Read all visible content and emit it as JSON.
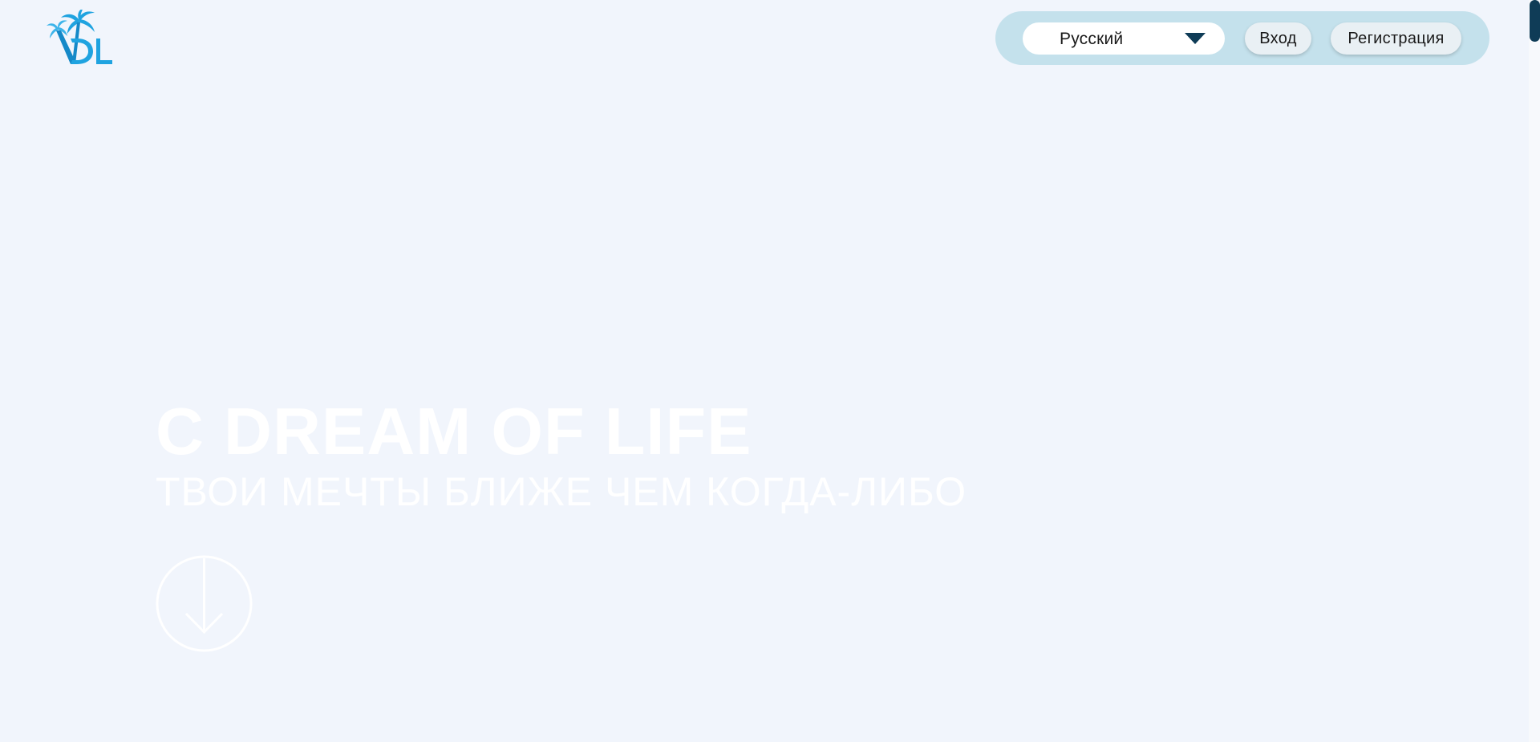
{
  "header": {
    "logo_icon": "vdl-palm-logo-icon",
    "language": {
      "selected": "Русский",
      "icon": "caret-down-icon"
    },
    "login_label": "Вход",
    "register_label": "Регистрация"
  },
  "hero": {
    "title": "С DREAM OF LIFE",
    "subtitle": "ТВОИ МЕЧТЫ БЛИЖЕ ЧЕМ КОГДА-ЛИБО",
    "scroll_icon": "arrow-down-circle-icon"
  },
  "colors": {
    "background": "#f1f5fc",
    "nav_pill": "#c4e1ec",
    "accent_dark": "#0f3c57",
    "logo_blue": "#1fa3e0",
    "hero_text": "#ffffff"
  }
}
